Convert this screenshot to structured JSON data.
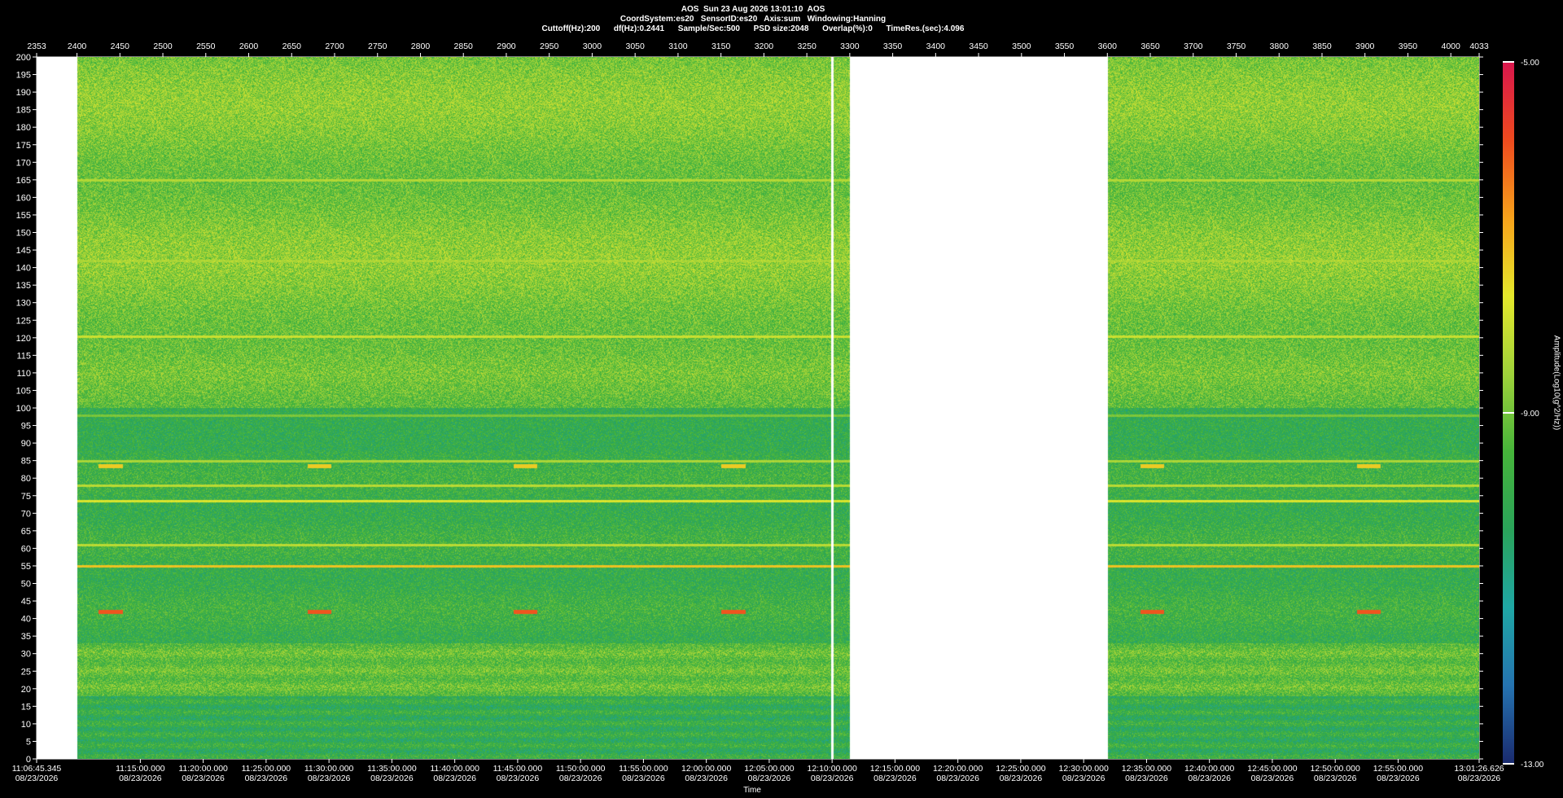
{
  "header": {
    "line1": "AOS  Sun 23 Aug 2026 13:01:10  AOS",
    "line2": "CoordSystem:es20   SensorID:es20   Axis:sum   Windowing:Hanning",
    "line3": "Cuttoff(Hz):200      df(Hz):0.2441      Sample/Sec:500      PSD size:2048      Overlap(%):0      TimeRes.(sec):4.096"
  },
  "chart_data": {
    "type": "heatmap",
    "title": "AOS  Sun 23 Aug 2026 13:01:10  AOS",
    "xlabel": "Time",
    "ylabel": "",
    "colorbar_label": "Amplitude(Log10(g^2/Hz))",
    "colorbar_ticks": [
      "-5.00",
      "-9.00",
      "-13.00"
    ],
    "colorbar_range": [
      -13,
      -5
    ],
    "colormap": [
      "#1a2a6e",
      "#2573b0",
      "#1fa7a5",
      "#2aa35a",
      "#46b43a",
      "#9fd23a",
      "#e5e82b",
      "#f7a21b",
      "#ee4a1e",
      "#d9164d"
    ],
    "ylim": [
      0,
      200
    ],
    "y_ticks": [
      0,
      5,
      10,
      15,
      20,
      25,
      30,
      35,
      40,
      45,
      50,
      55,
      60,
      65,
      70,
      75,
      80,
      85,
      90,
      95,
      100,
      105,
      110,
      115,
      120,
      125,
      130,
      135,
      140,
      145,
      150,
      155,
      160,
      165,
      170,
      175,
      180,
      185,
      190,
      195,
      200
    ],
    "top_axis": {
      "range": [
        2353,
        4033
      ],
      "ticks": [
        2353,
        2400,
        2450,
        2500,
        2550,
        2600,
        2650,
        2700,
        2750,
        2800,
        2850,
        2900,
        2950,
        3000,
        3050,
        3100,
        3150,
        3200,
        3250,
        3300,
        3350,
        3400,
        3450,
        3500,
        3550,
        3600,
        3650,
        3700,
        3750,
        3800,
        3850,
        3900,
        3950,
        4000,
        4033
      ]
    },
    "bottom_axis": {
      "date": "08/23/2026",
      "times": [
        "11:06:45.345",
        "11:15:00.000",
        "11:20:00.000",
        "11:25:00.000",
        "11:30:00.000",
        "11:35:00.000",
        "11:40:00.000",
        "11:45:00.000",
        "11:50:00.000",
        "11:55:00.000",
        "12:00:00.000",
        "12:05:00.000",
        "12:10:00.000",
        "12:15:00.000",
        "12:20:00.000",
        "12:25:00.000",
        "12:30:00.000",
        "12:35:00.000",
        "12:40:00.000",
        "12:45:00.000",
        "12:50:00.000",
        "12:55:00.000",
        "13:01:26.626"
      ]
    },
    "data_segments": [
      [
        2400,
        3278
      ],
      [
        3281,
        3300
      ],
      [
        3600,
        4033
      ]
    ],
    "tonal_lines_hz": [
      {
        "hz": 165,
        "level": -8.3
      },
      {
        "hz": 142,
        "level": -8.5
      },
      {
        "hz": 120.5,
        "level": -8.0
      },
      {
        "hz": 98,
        "level": -8.9
      },
      {
        "hz": 85,
        "level": -8.4
      },
      {
        "hz": 78,
        "level": -8.2
      },
      {
        "hz": 73.5,
        "level": -7.8
      },
      {
        "hz": 61,
        "level": -8.2
      },
      {
        "hz": 55,
        "level": -7.2
      }
    ],
    "intermittent_tones": [
      {
        "hz": 83.5,
        "level": -7.3,
        "starts": [
          2425,
          2668,
          2908,
          3150,
          3638,
          3890
        ]
      },
      {
        "hz": 42,
        "level": -6.0,
        "starts": [
          2425,
          2668,
          2908,
          3150,
          3638,
          3890
        ]
      }
    ],
    "grid": false
  }
}
